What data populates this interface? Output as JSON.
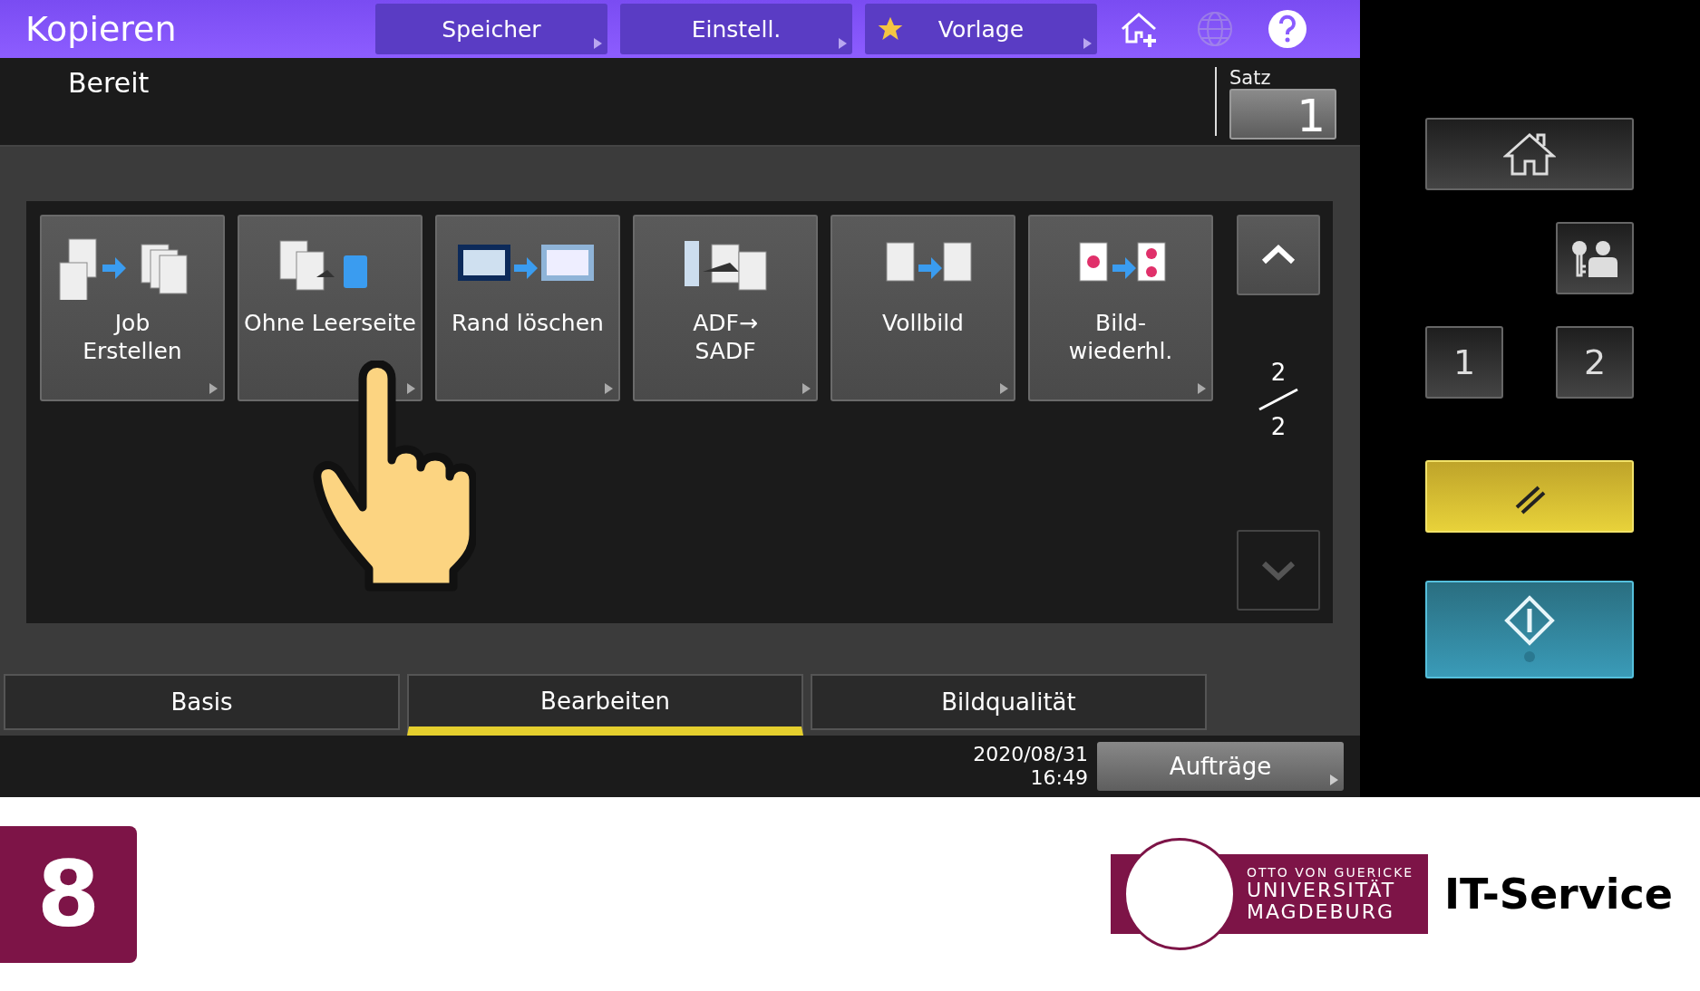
{
  "header": {
    "title": "Kopieren",
    "buttons": [
      {
        "label": "Speicher",
        "star": false
      },
      {
        "label": "Einstell.",
        "star": false
      },
      {
        "label": "Vorlage",
        "star": true
      }
    ],
    "globe_disabled": true
  },
  "status": {
    "text": "Bereit",
    "sets_label": "Satz",
    "sets_value": "1"
  },
  "tiles": [
    {
      "kind": "job-build",
      "lines": [
        "Job",
        "Erstellen"
      ]
    },
    {
      "kind": "skip-blank",
      "lines": [
        "Ohne Leerseite"
      ]
    },
    {
      "kind": "edge-erase",
      "lines": [
        "Rand löschen"
      ]
    },
    {
      "kind": "adf",
      "lines": [
        "ADF→",
        "SADF"
      ]
    },
    {
      "kind": "full-image",
      "lines": [
        "Vollbild"
      ]
    },
    {
      "kind": "image-repeat",
      "lines": [
        "Bild-",
        "wiederhl."
      ]
    }
  ],
  "pager": {
    "current": "2",
    "total": "2",
    "up_disabled": false,
    "down_disabled": true
  },
  "tabs": [
    {
      "label": "Basis",
      "selected": false
    },
    {
      "label": "Bearbeiten",
      "selected": true
    },
    {
      "label": "Bildqualität",
      "selected": false
    }
  ],
  "footer": {
    "date": "2020/08/31",
    "time": "16:49",
    "jobs": "Aufträge"
  },
  "keys": {
    "one": "1",
    "two": "2"
  },
  "slide": {
    "step": "8",
    "logo_lines": [
      "OTTO VON GUERICKE",
      "UNIVERSITÄT",
      "MAGDEBURG"
    ],
    "department": "IT-Service"
  }
}
